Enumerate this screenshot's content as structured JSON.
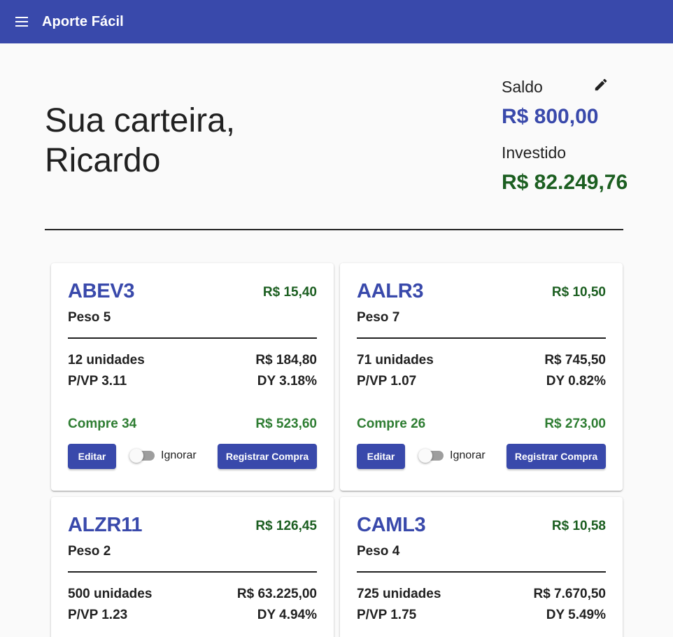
{
  "appbar": {
    "title": "Aporte Fácil",
    "menu_icon": "menu-icon"
  },
  "header": {
    "greeting_line1": "Sua carteira,",
    "greeting_line2": "Ricardo"
  },
  "summary": {
    "saldo_label": "Saldo",
    "saldo_value": "R$ 800,00",
    "investido_label": "Investido",
    "investido_value": "R$ 82.249,76",
    "edit_icon": "pencil-icon"
  },
  "labels": {
    "edit_button": "Editar",
    "ignore_toggle": "Ignorar",
    "register_button": "Registrar Compra"
  },
  "colors": {
    "primary": "#3949ab",
    "positive": "#1b5e20",
    "buy": "#2e7d32"
  },
  "cards": [
    {
      "ticker": "ABEV3",
      "price": "R$ 15,40",
      "peso": "Peso 5",
      "units": "12 unidades",
      "total": "R$ 184,80",
      "pvp": "P/VP 3.11",
      "dy": "DY 3.18%",
      "buy": "Compre 34",
      "buy_total": "R$ 523,60"
    },
    {
      "ticker": "AALR3",
      "price": "R$ 10,50",
      "peso": "Peso 7",
      "units": "71 unidades",
      "total": "R$ 745,50",
      "pvp": "P/VP 1.07",
      "dy": "DY 0.82%",
      "buy": "Compre 26",
      "buy_total": "R$ 273,00"
    },
    {
      "ticker": "ALZR11",
      "price": "R$ 126,45",
      "peso": "Peso 2",
      "units": "500 unidades",
      "total": "R$ 63.225,00",
      "pvp": "P/VP 1.23",
      "dy": "DY 4.94%"
    },
    {
      "ticker": "CAML3",
      "price": "R$ 10,58",
      "peso": "Peso 4",
      "units": "725 unidades",
      "total": "R$ 7.670,50",
      "pvp": "P/VP 1.75",
      "dy": "DY 5.49%"
    }
  ]
}
